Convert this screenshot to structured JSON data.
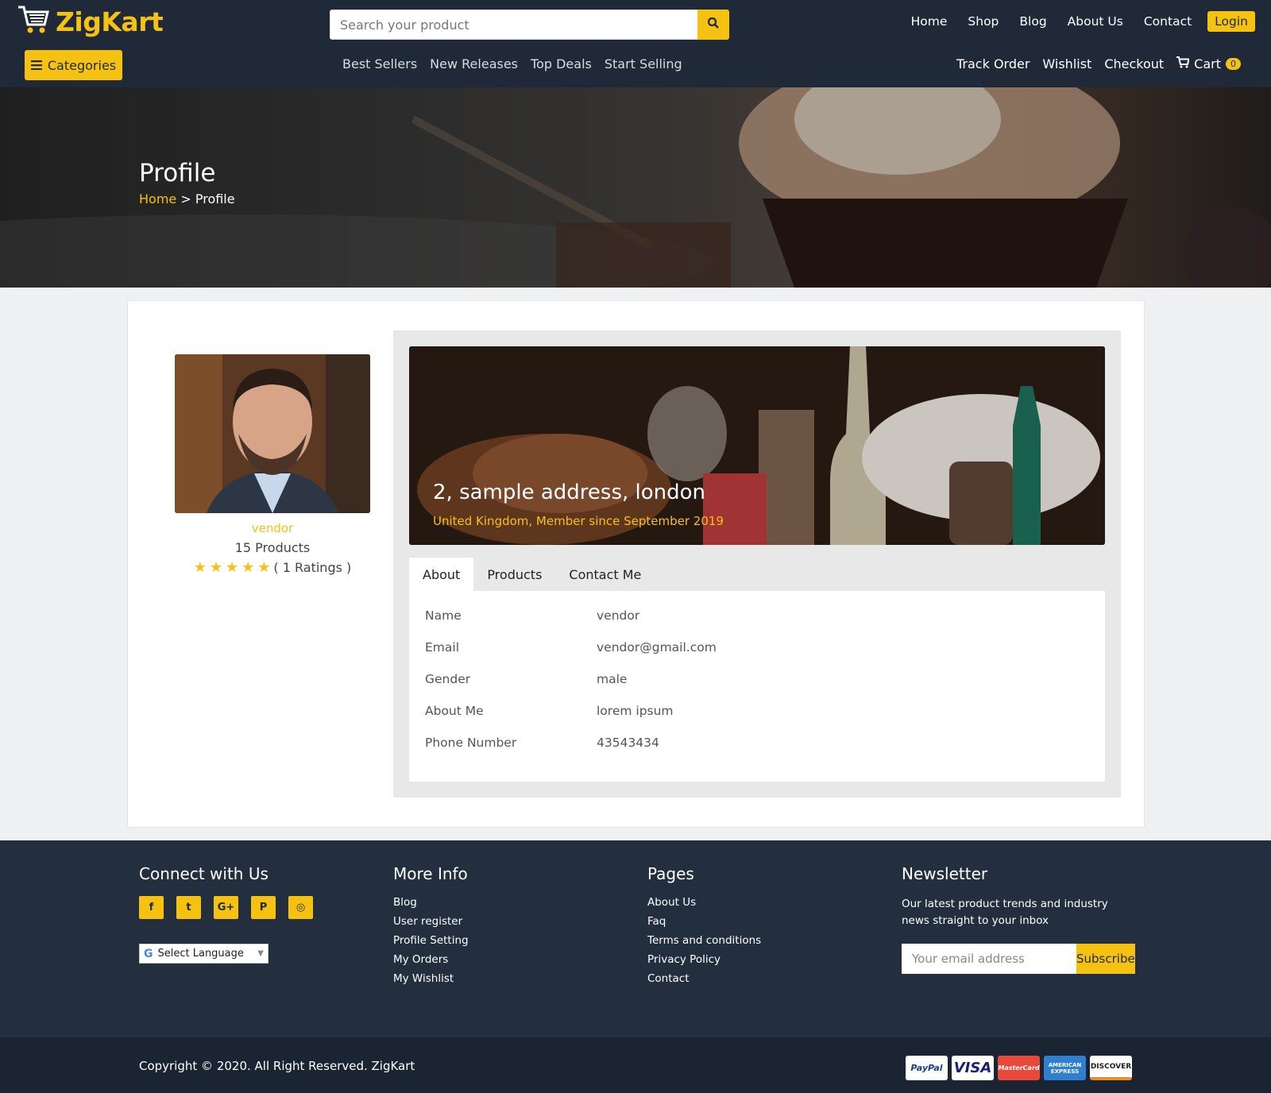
{
  "header": {
    "logo": "ZigKart",
    "search_placeholder": "Search your product",
    "top_nav": [
      "Home",
      "Shop",
      "Blog",
      "About Us",
      "Contact"
    ],
    "login_label": "Login",
    "categories_label": "Categories",
    "mid_nav": [
      "Best Sellers",
      "New Releases",
      "Top Deals",
      "Start Selling"
    ],
    "right_nav": [
      "Track Order",
      "Wishlist",
      "Checkout"
    ],
    "cart_label": "Cart",
    "cart_count": "0"
  },
  "hero": {
    "title": "Profile",
    "breadcrumb_home": "Home",
    "breadcrumb_sep": ">",
    "breadcrumb_current": "Profile"
  },
  "vendor": {
    "name": "vendor",
    "products": "15 Products",
    "rating_stars": 5,
    "rating_text": "( 1 Ratings )"
  },
  "banner": {
    "address": "2, sample address, london",
    "subtitle": "United Kingdom, Member since September 2019"
  },
  "tabs": [
    "About",
    "Products",
    "Contact Me"
  ],
  "about": [
    {
      "label": "Name",
      "value": "vendor"
    },
    {
      "label": "Email",
      "value": "vendor@gmail.com"
    },
    {
      "label": "Gender",
      "value": "male"
    },
    {
      "label": "About Me",
      "value": "lorem ipsum"
    },
    {
      "label": "Phone Number",
      "value": "43543434"
    }
  ],
  "footer": {
    "connect_title": "Connect with Us",
    "socials": [
      "f",
      "t",
      "G+",
      "P",
      "◎"
    ],
    "language": "Select Language",
    "more_info_title": "More Info",
    "more_info": [
      "Blog",
      "User register",
      "Profile Setting",
      "My Orders",
      "My Wishlist"
    ],
    "pages_title": "Pages",
    "pages": [
      "About Us",
      "Faq",
      "Terms and conditions",
      "Privacy Policy",
      "Contact"
    ],
    "newsletter_title": "Newsletter",
    "newsletter_text": "Our latest product trends and industry news straight to your inbox",
    "email_placeholder": "Your email address",
    "subscribe_label": "Subscribe",
    "copyright": "Copyright © 2020. All Right Reserved. ZigKart",
    "payments": [
      "PayPal",
      "VISA",
      "MasterCard",
      "AMERICAN EXPRESS",
      "DISCOVER"
    ]
  },
  "colors": {
    "accent": "#f5c211",
    "header_bg": "#1f2937",
    "footer_bg": "#232f3e"
  }
}
